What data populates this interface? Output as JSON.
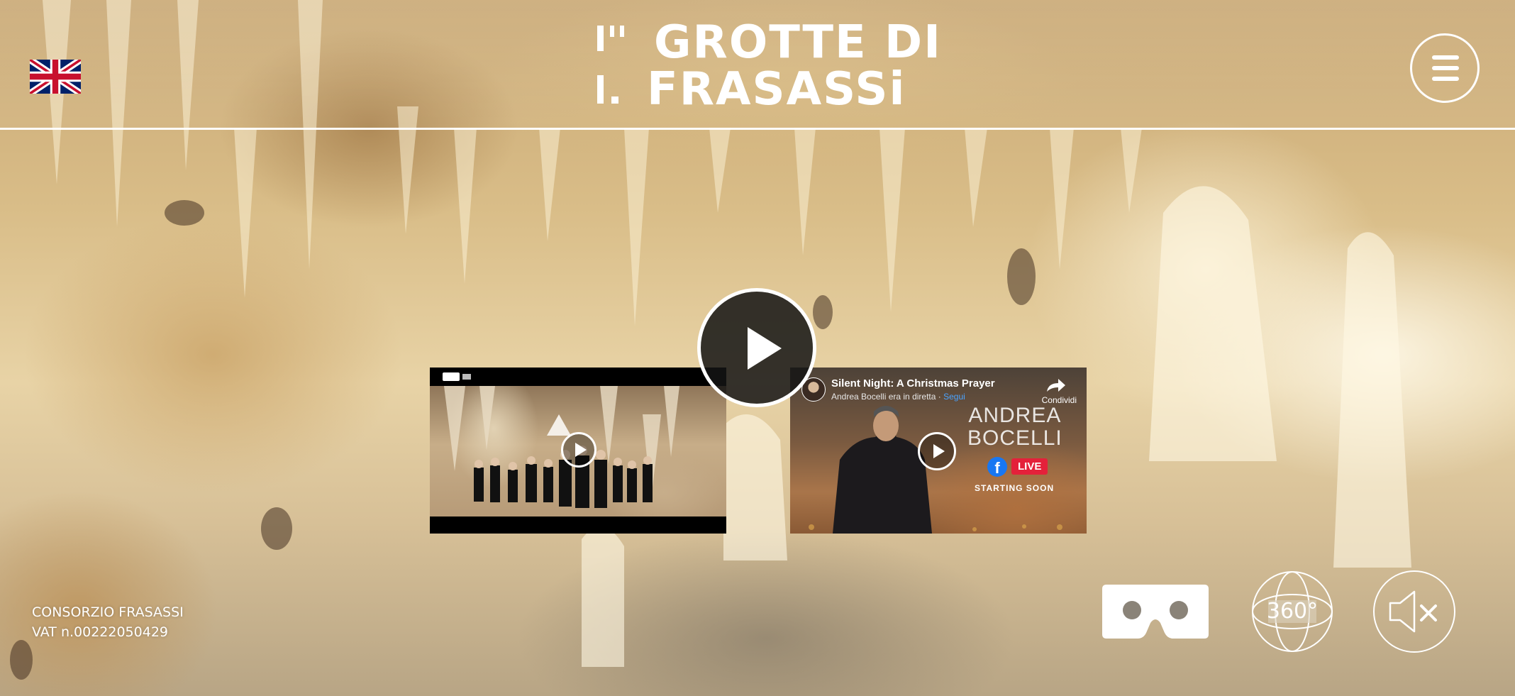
{
  "header": {
    "logo_line1": "GROTTE DI",
    "logo_line2": "FRASASSi",
    "language_flag": "uk-flag-icon",
    "menu_icon": "hamburger-menu-icon"
  },
  "main": {
    "big_play_icon": "play-icon",
    "videos": [
      {
        "id": "rai-concert-video",
        "play_icon": "play-icon"
      },
      {
        "id": "facebook-live-video",
        "title": "Silent Night: A Christmas Prayer",
        "subtitle_text": "Andrea Bocelli era in diretta · ",
        "subtitle_follow": "Segui",
        "share_label": "Condividi",
        "artist_line1": "ANDREA",
        "artist_line2": "BOCELLI",
        "facebook_letter": "f",
        "live_badge": "LIVE",
        "status": "STARTING SOON",
        "play_icon": "play-icon"
      }
    ]
  },
  "footer": {
    "company": "CONSORZIO FRASASSI",
    "vat": "VAT n.00222050429",
    "vr_icon": "vr-headset-icon",
    "view360_label": "360°",
    "mute_icon": "speaker-muted-icon"
  },
  "colors": {
    "foreground": "#ffffff",
    "live_red": "#e4213a",
    "facebook_blue": "#1877f2",
    "follow_blue": "#4aa3ff"
  }
}
